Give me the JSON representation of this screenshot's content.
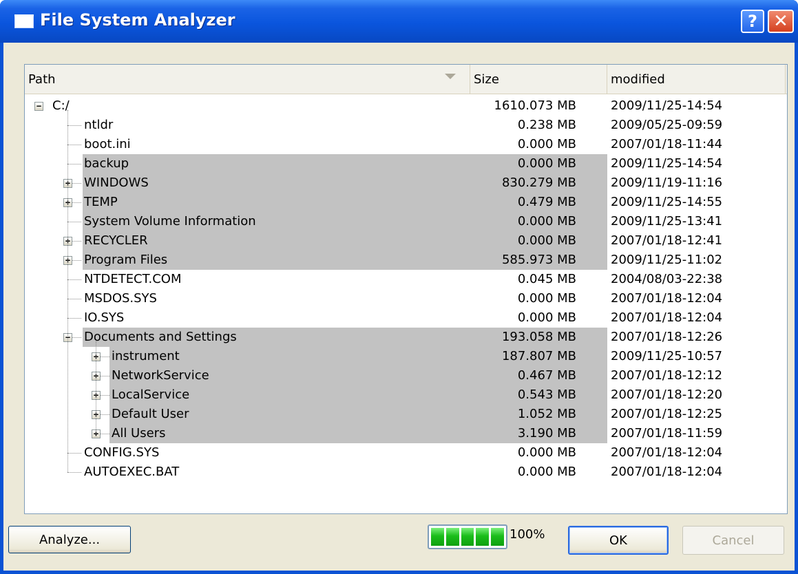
{
  "window": {
    "title": "File System Analyzer"
  },
  "columns": [
    "Path",
    "Size",
    "modified"
  ],
  "rows": [
    {
      "name": "C:/",
      "size": "1610.073 MB",
      "modified": "2009/11/25-14:54",
      "level": 0,
      "expander": "minus",
      "hl": false
    },
    {
      "name": "ntldr",
      "size": "0.238 MB",
      "modified": "2009/05/25-09:59",
      "level": 1,
      "expander": "none",
      "hl": false
    },
    {
      "name": "boot.ini",
      "size": "0.000 MB",
      "modified": "2007/01/18-11:44",
      "level": 1,
      "expander": "none",
      "hl": false
    },
    {
      "name": "backup",
      "size": "0.000 MB",
      "modified": "2009/11/25-14:54",
      "level": 1,
      "expander": "none",
      "hl": true
    },
    {
      "name": "WINDOWS",
      "size": "830.279 MB",
      "modified": "2009/11/19-11:16",
      "level": 1,
      "expander": "plus",
      "hl": true
    },
    {
      "name": "TEMP",
      "size": "0.479 MB",
      "modified": "2009/11/25-14:55",
      "level": 1,
      "expander": "plus",
      "hl": true
    },
    {
      "name": "System Volume Information",
      "size": "0.000 MB",
      "modified": "2009/11/25-13:41",
      "level": 1,
      "expander": "none",
      "hl": true
    },
    {
      "name": "RECYCLER",
      "size": "0.000 MB",
      "modified": "2007/01/18-12:41",
      "level": 1,
      "expander": "plus",
      "hl": true
    },
    {
      "name": "Program Files",
      "size": "585.973 MB",
      "modified": "2009/11/25-11:02",
      "level": 1,
      "expander": "plus",
      "hl": true
    },
    {
      "name": "NTDETECT.COM",
      "size": "0.045 MB",
      "modified": "2004/08/03-22:38",
      "level": 1,
      "expander": "none",
      "hl": false
    },
    {
      "name": "MSDOS.SYS",
      "size": "0.000 MB",
      "modified": "2007/01/18-12:04",
      "level": 1,
      "expander": "none",
      "hl": false
    },
    {
      "name": "IO.SYS",
      "size": "0.000 MB",
      "modified": "2007/01/18-12:04",
      "level": 1,
      "expander": "none",
      "hl": false
    },
    {
      "name": "Documents and Settings",
      "size": "193.058 MB",
      "modified": "2007/01/18-12:26",
      "level": 1,
      "expander": "minus",
      "hl": true
    },
    {
      "name": "instrument",
      "size": "187.807 MB",
      "modified": "2009/11/25-10:57",
      "level": 2,
      "expander": "plus",
      "hl": true
    },
    {
      "name": "NetworkService",
      "size": "0.467 MB",
      "modified": "2007/01/18-12:12",
      "level": 2,
      "expander": "plus",
      "hl": true
    },
    {
      "name": "LocalService",
      "size": "0.543 MB",
      "modified": "2007/01/18-12:20",
      "level": 2,
      "expander": "plus",
      "hl": true
    },
    {
      "name": "Default User",
      "size": "1.052 MB",
      "modified": "2007/01/18-12:25",
      "level": 2,
      "expander": "plus",
      "hl": true
    },
    {
      "name": "All Users",
      "size": "3.190 MB",
      "modified": "2007/01/18-11:59",
      "level": 2,
      "expander": "plus",
      "hl": true
    },
    {
      "name": "CONFIG.SYS",
      "size": "0.000 MB",
      "modified": "2007/01/18-12:04",
      "level": 1,
      "expander": "none",
      "hl": false
    },
    {
      "name": "AUTOEXEC.BAT",
      "size": "0.000 MB",
      "modified": "2007/01/18-12:04",
      "level": 1,
      "expander": "none",
      "hl": false
    }
  ],
  "buttons": {
    "analyze": "Analyze...",
    "ok": "OK",
    "cancel": "Cancel"
  },
  "progress": {
    "value": 1.0,
    "label": "100%"
  },
  "colors": {
    "titlebar": "#0a55dd",
    "highlight": "#c2c2c2",
    "progress": "#1bbd1b",
    "dialog": "#ece9d8"
  }
}
